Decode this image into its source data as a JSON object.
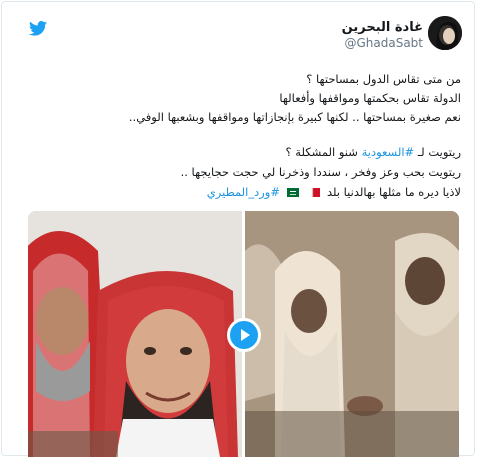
{
  "author": {
    "name": "غادة البحرين",
    "handle": "@GhadaSabt"
  },
  "tweet": {
    "lines": [
      "من متى تقاس الدول بمساحتها ؟",
      "الدولة تقاس بحكمتها ومواقفها وأفعالها",
      "نعم صغيرة بمساحتها .. لكنها كبيرة بإنجازاتها ومواقفها وبشعبها الوفي..",
      "ريتويت لـ",
      "#السعودية",
      "شنو المشكلة ؟",
      "ريتويت بحب وعز وفخر ، سنددا وذخرنا لي حجت حجايجها ..",
      "لاذيا ديره ما مثلها بهالدنيا بلد",
      "#ورد_المطيري"
    ]
  },
  "icons": {
    "bird": "twitter-bird-icon",
    "play": "play-icon",
    "flag_bahrain": "bahrain-flag-icon",
    "flag_saudi": "saudi-flag-icon"
  },
  "colors": {
    "accent": "#1da1f2",
    "link": "#1b95e0",
    "text": "#14171a",
    "muted": "#657786"
  }
}
